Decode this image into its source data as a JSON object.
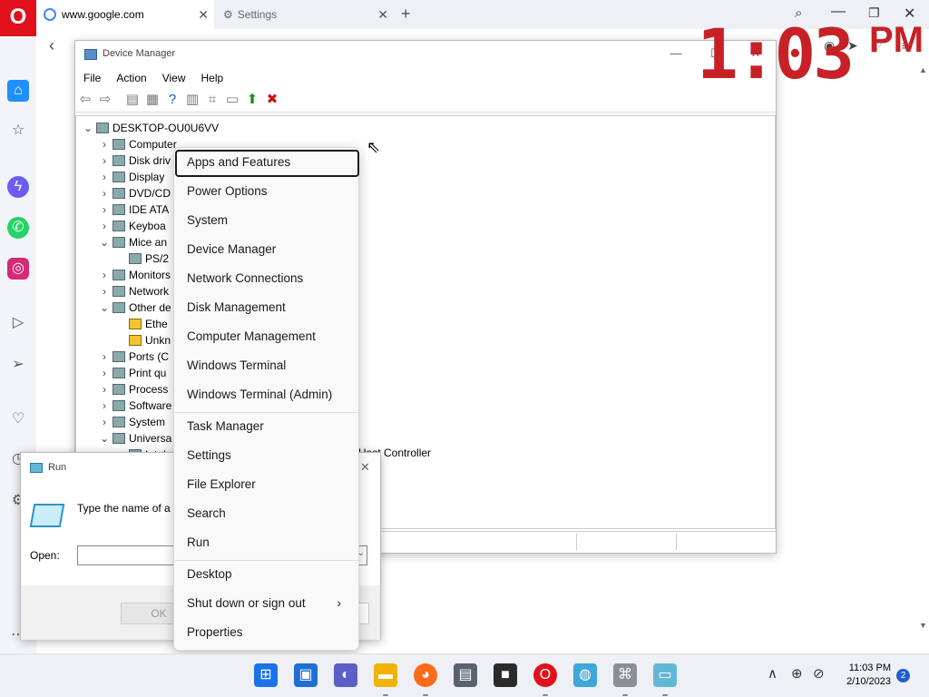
{
  "browser": {
    "tabs": [
      {
        "label": "www.google.com",
        "icon": "google-icon"
      },
      {
        "label": "Settings",
        "icon": "gear-icon"
      }
    ],
    "new_tab_symbol": "+",
    "sidebar_icons": [
      "home-icon",
      "star-icon",
      "messenger-icon",
      "whatsapp-icon",
      "instagram-icon",
      "player-icon",
      "send-icon",
      "heart-icon",
      "history-icon",
      "settings-icon",
      "more-icon"
    ]
  },
  "overlay_clock": {
    "time": "1:03",
    "suffix": "PM",
    "color": "#c72127"
  },
  "device_manager": {
    "title": "Device Manager",
    "menu": [
      "File",
      "Action",
      "View",
      "Help"
    ],
    "root": "DESKTOP-OU0U6VV",
    "nodes": [
      {
        "label": "Computer",
        "expanded": false
      },
      {
        "label": "Disk driv",
        "expanded": false
      },
      {
        "label": "Display",
        "expanded": false
      },
      {
        "label": "DVD/CD",
        "expanded": false
      },
      {
        "label": "IDE ATA",
        "expanded": false
      },
      {
        "label": "Keyboa",
        "expanded": false
      },
      {
        "label": "Mice an",
        "expanded": true
      },
      {
        "label": "PS/2",
        "child": true
      },
      {
        "label": "Monitors",
        "expanded": false
      },
      {
        "label": "Network",
        "expanded": false
      },
      {
        "label": "Other de",
        "expanded": true
      },
      {
        "label": "Ethe",
        "child": true,
        "warning": true
      },
      {
        "label": "Unkn",
        "child": true,
        "warning": true
      },
      {
        "label": "Ports (C",
        "expanded": false
      },
      {
        "label": "Print qu",
        "expanded": false
      },
      {
        "label": "Process",
        "expanded": false
      },
      {
        "label": "Software",
        "expanded": false
      },
      {
        "label": "System",
        "expanded": false
      },
      {
        "label": "Universa",
        "expanded": true
      },
      {
        "label": "Intel",
        "child": true
      }
    ],
    "partial_row_text": "Host Controller"
  },
  "run_dialog": {
    "title": "Run",
    "description": "Type the name of a p resource, and Windo",
    "open_label": "Open:",
    "open_value": "",
    "ok_label": "OK"
  },
  "context_menu": {
    "groups": [
      [
        "Apps and Features",
        "Power Options",
        "System",
        "Device Manager",
        "Network Connections",
        "Disk Management",
        "Computer Management",
        "Windows Terminal",
        "Windows Terminal (Admin)"
      ],
      [
        "Task Manager",
        "Settings",
        "File Explorer",
        "Search",
        "Run"
      ],
      [
        "Desktop",
        "Shut down or sign out",
        "Properties"
      ]
    ],
    "submenu_arrow": "›"
  },
  "taskbar": {
    "apps": [
      "start-icon",
      "widgets-icon",
      "chat-icon",
      "file-explorer-icon",
      "firefox-icon",
      "notepad-icon",
      "media-icon",
      "opera-icon",
      "maps-icon",
      "device-manager-icon",
      "run-icon"
    ],
    "time": "11:03 PM",
    "date": "2/10/2023",
    "notification_count": "2"
  }
}
